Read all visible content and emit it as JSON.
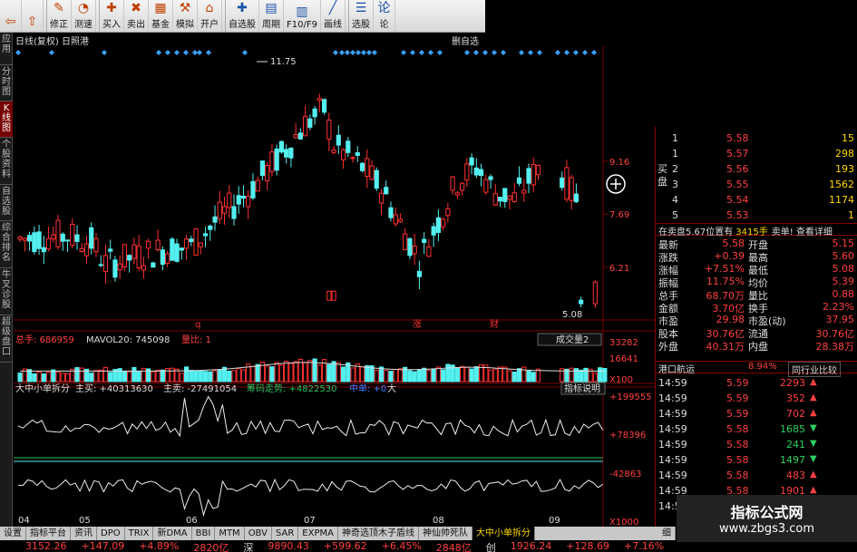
{
  "toolbar": {
    "items": [
      {
        "label": "",
        "icon": "back-arrow-icon"
      },
      {
        "label": "",
        "icon": "forward-arrow-icon"
      },
      {
        "label": "修正",
        "icon": "edit-icon"
      },
      {
        "label": "测速",
        "icon": "speed-test-icon"
      },
      {
        "label": "买入",
        "icon": "buy-icon"
      },
      {
        "label": "卖出",
        "icon": "sell-icon"
      },
      {
        "label": "基金",
        "icon": "fund-icon"
      },
      {
        "label": "模拟",
        "icon": "simulate-icon"
      },
      {
        "label": "开户",
        "icon": "account-icon"
      },
      {
        "label": "自选股",
        "icon": "watchlist-icon"
      },
      {
        "label": "周期",
        "icon": "period-icon"
      },
      {
        "label": "F10/F9",
        "icon": "f10-icon"
      },
      {
        "label": "画线",
        "icon": "draw-line-icon"
      },
      {
        "label": "选股",
        "icon": "stock-screen-icon"
      },
      {
        "label": "论",
        "icon": "forum-icon"
      }
    ]
  },
  "leftnav": [
    "应用",
    "分时图",
    "K线图",
    "个股资料",
    "自选股",
    "综合排名",
    "牛叉诊股",
    "超级盘口"
  ],
  "chart": {
    "title_left": "日线(复权)  日照港",
    "title_right": "删自选",
    "high_label": "11.75",
    "low_label": "5.08",
    "price_ticks": [
      "9.16",
      "7.69",
      "6.21"
    ],
    "markers": [
      "q",
      "涨",
      "财"
    ]
  },
  "volume_panel": {
    "label_total": "总手: 686959",
    "label_mavol": "MAVOL20: 745098",
    "label_ratio": "量比: 1",
    "button": "成交量2",
    "ticks": [
      "33282",
      "16641",
      "X100"
    ]
  },
  "indicator_panel": {
    "label_name": "大中小单拆分",
    "label_main_buy": "主买: +40313630",
    "label_main_sell": "主卖: -27491054",
    "label_trend": "筹码走势: +4822530",
    "label_mid": "中单: +0",
    "label_big": "大",
    "button": "指标说明",
    "ticks": [
      "+199555",
      "+78396",
      "-42863",
      "X1000"
    ]
  },
  "x_axis": [
    "04",
    "05",
    "06",
    "07",
    "08",
    "09"
  ],
  "chart_data": {
    "type": "candlestick",
    "high": 11.75,
    "low": 5.08,
    "price_axis": [
      6.21,
      7.69,
      9.16
    ],
    "volume_axis": [
      16641,
      33282
    ],
    "indicator_axis": [
      -42863,
      78396,
      199555
    ]
  },
  "orderbook": {
    "side_buy_label": "买盘",
    "rows": [
      {
        "level": "1",
        "price": "5.58",
        "vol": "15"
      },
      {
        "level": "1",
        "price": "5.57",
        "vol": "298"
      },
      {
        "level": "2",
        "price": "5.56",
        "vol": "193"
      },
      {
        "level": "3",
        "price": "5.55",
        "vol": "1562"
      },
      {
        "level": "4",
        "price": "5.54",
        "vol": "1174"
      },
      {
        "level": "5",
        "price": "5.53",
        "vol": "1"
      }
    ]
  },
  "quote_header": {
    "left": "在卖盘5.67位置有",
    "mid": "3415手",
    "right": "卖单! 查看详细"
  },
  "quote": [
    {
      "k1": "最新",
      "v1": "5.58",
      "k2": "开盘",
      "v2": "5.15"
    },
    {
      "k1": "涨跌",
      "v1": "+0.39",
      "k2": "最高",
      "v2": "5.60"
    },
    {
      "k1": "涨幅",
      "v1": "+7.51%",
      "k2": "最低",
      "v2": "5.08"
    },
    {
      "k1": "振幅",
      "v1": "11.75%",
      "k2": "均价",
      "v2": "5.39"
    },
    {
      "k1": "总手",
      "v1": "68.70万",
      "k2": "量比",
      "v2": "0.88"
    },
    {
      "k1": "金额",
      "v1": "3.70亿",
      "k2": "换手",
      "v2": "2.23%"
    },
    {
      "k1": "市盈",
      "v1": "29.98",
      "k2": "市盈(动)",
      "v2": "37.95"
    },
    {
      "k1": "股本",
      "v1": "30.76亿",
      "k2": "流通",
      "v2": "30.76亿"
    },
    {
      "k1": "外盘",
      "v1": "40.31万",
      "k2": "内盘",
      "v2": "28.38万"
    }
  ],
  "sector": {
    "name": "港口航运",
    "pct": "8.94%",
    "button": "同行业比较"
  },
  "ticks": [
    {
      "t": "14:59",
      "p": "5.59",
      "v": "2293",
      "dir": "up"
    },
    {
      "t": "14:59",
      "p": "5.59",
      "v": "352",
      "dir": "up"
    },
    {
      "t": "14:59",
      "p": "5.59",
      "v": "702",
      "dir": "up"
    },
    {
      "t": "14:59",
      "p": "5.58",
      "v": "1685",
      "dir": "down"
    },
    {
      "t": "14:59",
      "p": "5.58",
      "v": "241",
      "dir": "down"
    },
    {
      "t": "14:59",
      "p": "5.58",
      "v": "1497",
      "dir": "down"
    },
    {
      "t": "14:59",
      "p": "5.58",
      "v": "483",
      "dir": "up"
    },
    {
      "t": "14:59",
      "p": "5.58",
      "v": "1901",
      "dir": "up"
    },
    {
      "t": "14:59",
      "p": "",
      "v": "",
      "dir": ""
    }
  ],
  "tabs": [
    "设置",
    "指标平台",
    "资讯",
    "DPO",
    "TRIX",
    "新DMA",
    "BBI",
    "MTM",
    "OBV",
    "SAR",
    "EXPMA",
    "神奇选顶木子盾线",
    "神仙帅死队",
    "大中小单拆分"
  ],
  "tab_right": "细",
  "status": [
    "3152.26",
    "+147.09",
    "+4.89%",
    "2820亿",
    "深",
    "9890.43",
    "+599.62",
    "+6.45%",
    "2848亿",
    "创",
    "1926.24",
    "+128.69",
    "+7.16%"
  ],
  "watermark": {
    "line1": "指标公式网",
    "line2": "www.zbgs3.com"
  },
  "colors": {
    "up": "#ff3030",
    "down": "#54f0f0",
    "ma": "#dddddd",
    "accent": "#ffd700"
  }
}
